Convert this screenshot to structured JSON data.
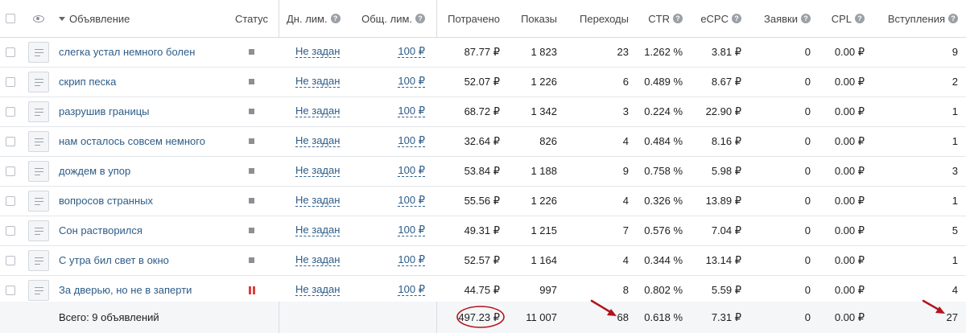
{
  "header": {
    "ad_label": "Объявление",
    "status": "Статус",
    "daily_limit": "Дн. лим.",
    "total_limit": "Общ. лим.",
    "spent": "Потрачено",
    "impressions": "Показы",
    "clicks": "Переходы",
    "ctr": "CTR",
    "ecpc": "eCPC",
    "leads": "Заявки",
    "cpl": "CPL",
    "joins": "Вступления",
    "help_glyph": "?"
  },
  "rows": [
    {
      "title": "слегка устал немного болен",
      "status": "stopped",
      "daily": "Не задан",
      "total": "100 ₽",
      "spent": "87.77 ₽",
      "impr": "1 823",
      "clicks": "23",
      "ctr": "1.262 %",
      "ecpc": "3.81 ₽",
      "leads": "0",
      "cpl": "0.00 ₽",
      "joins": "9"
    },
    {
      "title": "скрип песка",
      "status": "stopped",
      "daily": "Не задан",
      "total": "100 ₽",
      "spent": "52.07 ₽",
      "impr": "1 226",
      "clicks": "6",
      "ctr": "0.489 %",
      "ecpc": "8.67 ₽",
      "leads": "0",
      "cpl": "0.00 ₽",
      "joins": "2"
    },
    {
      "title": "разрушив границы",
      "status": "stopped",
      "daily": "Не задан",
      "total": "100 ₽",
      "spent": "68.72 ₽",
      "impr": "1 342",
      "clicks": "3",
      "ctr": "0.224 %",
      "ecpc": "22.90 ₽",
      "leads": "0",
      "cpl": "0.00 ₽",
      "joins": "1"
    },
    {
      "title": "нам осталось совсем немного",
      "status": "stopped",
      "daily": "Не задан",
      "total": "100 ₽",
      "spent": "32.64 ₽",
      "impr": "826",
      "clicks": "4",
      "ctr": "0.484 %",
      "ecpc": "8.16 ₽",
      "leads": "0",
      "cpl": "0.00 ₽",
      "joins": "1"
    },
    {
      "title": "дождем в упор",
      "status": "stopped",
      "daily": "Не задан",
      "total": "100 ₽",
      "spent": "53.84 ₽",
      "impr": "1 188",
      "clicks": "9",
      "ctr": "0.758 %",
      "ecpc": "5.98 ₽",
      "leads": "0",
      "cpl": "0.00 ₽",
      "joins": "3"
    },
    {
      "title": "вопросов странных",
      "status": "stopped",
      "daily": "Не задан",
      "total": "100 ₽",
      "spent": "55.56 ₽",
      "impr": "1 226",
      "clicks": "4",
      "ctr": "0.326 %",
      "ecpc": "13.89 ₽",
      "leads": "0",
      "cpl": "0.00 ₽",
      "joins": "1"
    },
    {
      "title": "Сон растворился",
      "status": "stopped",
      "daily": "Не задан",
      "total": "100 ₽",
      "spent": "49.31 ₽",
      "impr": "1 215",
      "clicks": "7",
      "ctr": "0.576 %",
      "ecpc": "7.04 ₽",
      "leads": "0",
      "cpl": "0.00 ₽",
      "joins": "5"
    },
    {
      "title": "С утра бил свет в окно",
      "status": "stopped",
      "daily": "Не задан",
      "total": "100 ₽",
      "spent": "52.57 ₽",
      "impr": "1 164",
      "clicks": "4",
      "ctr": "0.344 %",
      "ecpc": "13.14 ₽",
      "leads": "0",
      "cpl": "0.00 ₽",
      "joins": "1"
    },
    {
      "title": "За дверью, но не в заперти",
      "status": "paused",
      "daily": "Не задан",
      "total": "100 ₽",
      "spent": "44.75 ₽",
      "impr": "997",
      "clicks": "8",
      "ctr": "0.802 %",
      "ecpc": "5.59 ₽",
      "leads": "0",
      "cpl": "0.00 ₽",
      "joins": "4"
    }
  ],
  "footer": {
    "label": "Всего: 9 объявлений",
    "spent": "497.23 ₽",
    "impr": "11 007",
    "clicks": "68",
    "ctr": "0.618 %",
    "ecpc": "7.31 ₽",
    "leads": "0",
    "cpl": "0.00 ₽",
    "joins": "27"
  },
  "colors": {
    "link": "#2d5c88",
    "stopped": "#8c8f93",
    "paused": "#e03c3c",
    "annotation": "#b3141c"
  },
  "icons": [
    "eye-icon",
    "ad-thumbnail-icon",
    "sort-desc-icon",
    "help-icon",
    "arrow-annotation-icon",
    "circle-annotation-icon"
  ]
}
